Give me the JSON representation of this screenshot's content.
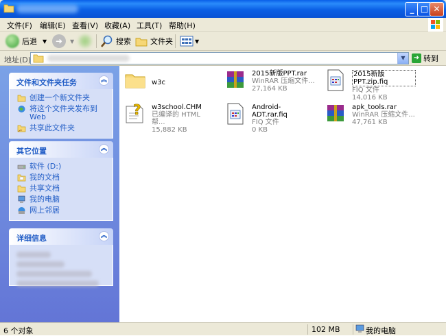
{
  "menu": [
    "文件(F)",
    "编辑(E)",
    "查看(V)",
    "收藏(A)",
    "工具(T)",
    "帮助(H)"
  ],
  "toolbar": {
    "back_label": "后退",
    "search_label": "搜索",
    "folders_label": "文件夹"
  },
  "address": {
    "label": "地址(D)",
    "go_label": "转到"
  },
  "panels": {
    "tasks": {
      "title": "文件和文件夹任务",
      "items": [
        "创建一个新文件夹",
        "将这个文件夹发布到 Web",
        "共享此文件夹"
      ]
    },
    "places": {
      "title": "其它位置",
      "items": [
        "软件 (D:)",
        "我的文档",
        "共享文档",
        "我的电脑",
        "网上邻居"
      ]
    },
    "details": {
      "title": "详细信息"
    }
  },
  "files": [
    {
      "name": "w3c",
      "type": "",
      "size": "",
      "icon": "folder-icon"
    },
    {
      "name": "2015新版PPT.rar",
      "type": "WinRAR 压缩文件...",
      "size": "27,164 KB",
      "icon": "winrar-icon"
    },
    {
      "name": "2015新版PPT.zip.fiq",
      "type": "FIQ 文件",
      "size": "14,016 KB",
      "icon": "fiq-file-icon"
    },
    {
      "name": "w3school.CHM",
      "type": "已编译的 HTML 帮...",
      "size": "15,882 KB",
      "icon": "chm-help-icon"
    },
    {
      "name": "Android-ADT.rar.fiq",
      "type": "FIQ 文件",
      "size": "0 KB",
      "icon": "fiq-file-icon"
    },
    {
      "name": "apk_tools.rar",
      "type": "WinRAR 压缩文件...",
      "size": "47,761 KB",
      "icon": "winrar-icon"
    }
  ],
  "status": {
    "objects": "6 个对象",
    "size": "102 MB",
    "location": "我的电脑"
  },
  "colors": {
    "titlebar": "#0a5fe8",
    "taskpane": "#6f8ddf",
    "link": "#215dc6"
  }
}
